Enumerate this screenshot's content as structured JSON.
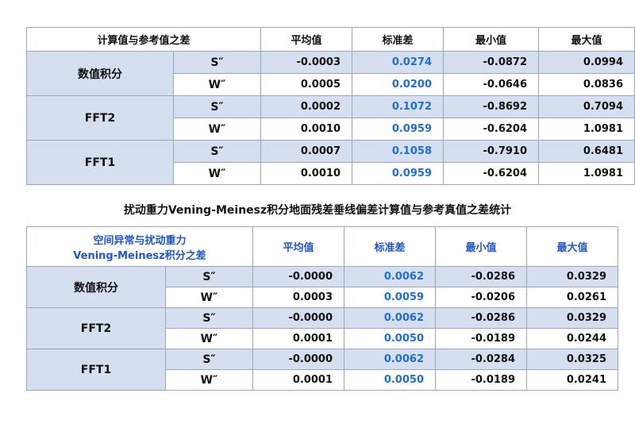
{
  "table1": {
    "header": [
      "计算值与参考值之差",
      "平均值",
      "标准差",
      "最小值",
      "最大值"
    ],
    "groups": [
      {
        "name": "数值积分",
        "rows": [
          {
            "label": "S″",
            "values": [
              "-0.0003",
              "0.0274",
              "-0.0872",
              "0.0994"
            ]
          },
          {
            "label": "W″",
            "values": [
              "0.0005",
              "0.0200",
              "-0.0646",
              "0.0836"
            ]
          }
        ]
      },
      {
        "name": "FFT2",
        "rows": [
          {
            "label": "S″",
            "values": [
              "0.0002",
              "0.1072",
              "-0.8692",
              "0.7094"
            ]
          },
          {
            "label": "W″",
            "values": [
              "0.0010",
              "0.0959",
              "-0.6204",
              "1.0981"
            ]
          }
        ]
      },
      {
        "name": "FFT1",
        "rows": [
          {
            "label": "S″",
            "values": [
              "0.0007",
              "0.1058",
              "-0.7910",
              "0.6481"
            ]
          },
          {
            "label": "W″",
            "values": [
              "0.0010",
              "0.0959",
              "-0.6204",
              "1.0981"
            ]
          }
        ]
      }
    ]
  },
  "caption": "扰动重力Vening-Meinesz积分地面残差垂线偏差计算值与参考真值之差统计",
  "table2": {
    "header_line1": "空间异常与扰动重力",
    "header_line2": "Vening-Meinesz积分之差",
    "header": [
      "平均值",
      "标准差",
      "最小值",
      "最大值"
    ],
    "groups": [
      {
        "name": "数值积分",
        "rows": [
          {
            "label": "S″",
            "values": [
              "-0.0000",
              "0.0062",
              "-0.0286",
              "0.0329"
            ]
          },
          {
            "label": "W″",
            "values": [
              "0.0003",
              "0.0059",
              "-0.0206",
              "0.0261"
            ]
          }
        ]
      },
      {
        "name": "FFT2",
        "rows": [
          {
            "label": "S″",
            "values": [
              "-0.0000",
              "0.0062",
              "-0.0286",
              "0.0329"
            ]
          },
          {
            "label": "W″",
            "values": [
              "0.0001",
              "0.0050",
              "-0.0189",
              "0.0244"
            ]
          }
        ]
      },
      {
        "name": "FFT1",
        "rows": [
          {
            "label": "S″",
            "values": [
              "-0.0000",
              "0.0062",
              "-0.0284",
              "0.0325"
            ]
          },
          {
            "label": "W″",
            "values": [
              "0.0001",
              "0.0050",
              "-0.0189",
              "0.0241"
            ]
          }
        ]
      }
    ]
  },
  "colors": {
    "row_fill": "#d6dff0",
    "std_text": "#1f6fd0",
    "header_blue": "#1f56c9",
    "border": "#9aa6bd"
  }
}
